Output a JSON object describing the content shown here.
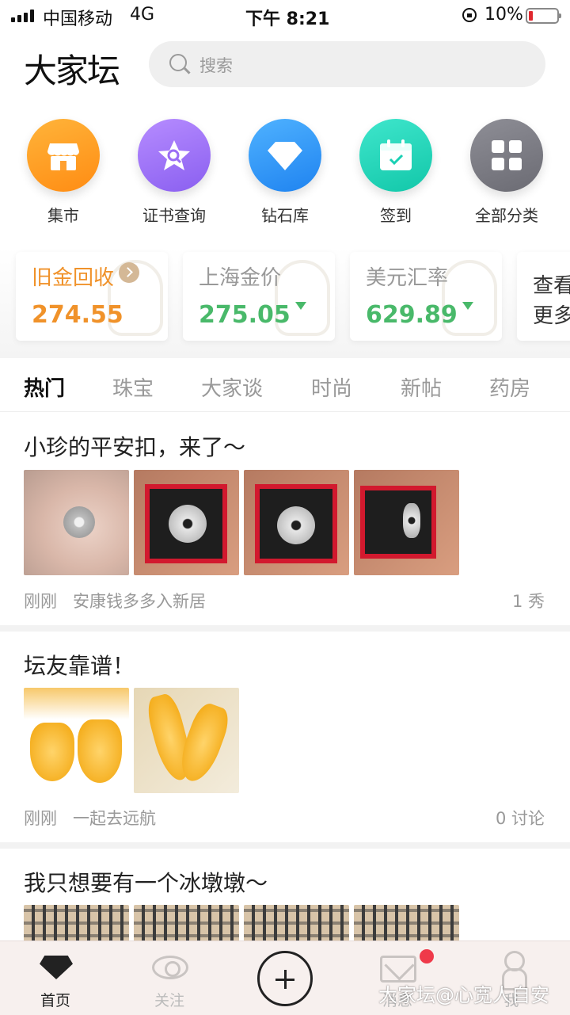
{
  "status_bar": {
    "carrier": "中国移动",
    "network": "4G",
    "time": "下午 8:21",
    "battery": "10%"
  },
  "header": {
    "logo": "大家坛",
    "search_placeholder": "搜索"
  },
  "quick_actions": [
    {
      "label": "集市",
      "icon": "shop-icon",
      "color": "#ff9a1f"
    },
    {
      "label": "证书查询",
      "icon": "certificate-star-icon",
      "color": "#9b6df5"
    },
    {
      "label": "钻石库",
      "icon": "diamond-icon",
      "color": "#2a92f5"
    },
    {
      "label": "签到",
      "icon": "calendar-check-icon",
      "color": "#1ad0b4"
    },
    {
      "label": "全部分类",
      "icon": "grid-icon",
      "color": "#7b7b83"
    }
  ],
  "price_cards": [
    {
      "title": "旧金回收",
      "value": "274.55",
      "color": "#f0922a"
    },
    {
      "title": "上海金价",
      "value": "275.05",
      "color": "#49b96a"
    },
    {
      "title": "美元汇率",
      "value": "629.89",
      "color": "#49b96a"
    },
    {
      "title_line1": "查看",
      "title_line2": "更多"
    }
  ],
  "tabs": [
    "热门",
    "珠宝",
    "大家谈",
    "时尚",
    "新帖",
    "药房"
  ],
  "posts": [
    {
      "title": "小珍的平安扣，来了～",
      "time": "刚刚",
      "author": "安康钱多多入新居",
      "stat": "1 秀"
    },
    {
      "title": "坛友靠谱！",
      "time": "刚刚",
      "author": "一起去远航",
      "stat": "0 讨论"
    },
    {
      "title": "我只想要有一个冰墩墩～"
    }
  ],
  "bottom_nav": [
    {
      "label": "首页",
      "icon": "home-diamond-icon"
    },
    {
      "label": "关注",
      "icon": "eye-icon"
    },
    {
      "label": "",
      "icon": "plus-icon"
    },
    {
      "label": "消息",
      "icon": "mail-icon"
    },
    {
      "label": "我",
      "icon": "person-icon"
    }
  ],
  "watermark": "大家坛@心宽人自安"
}
